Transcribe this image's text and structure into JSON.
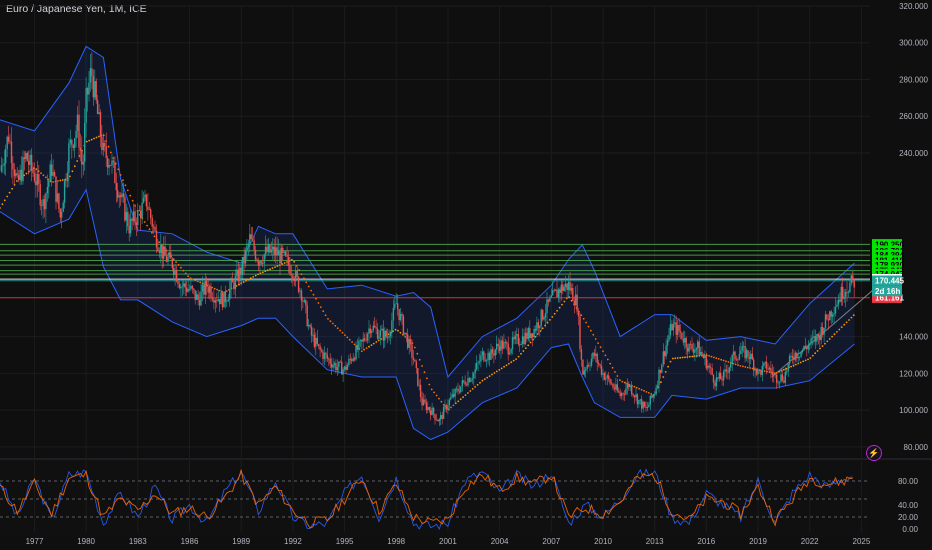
{
  "title": "Euro / Japanese Yen, 1M, ICE",
  "colors": {
    "bg": "#0f0f0f",
    "up": "#26a69a",
    "down": "#ef5350",
    "band": "#2962ff",
    "bandFill": "rgba(41,98,255,0.12)",
    "ma": "#ff9800",
    "ma2": "#ff6d00",
    "support": "#4caf50",
    "resistance": "#f23645",
    "white": "#ffffff",
    "grid": "#1c1c1c"
  },
  "icons": {
    "alert": "lightning-icon"
  },
  "chart_data": [
    {
      "type": "line",
      "title": "",
      "ylim": [
        75,
        320
      ],
      "xlim": [
        1975,
        2025.5
      ],
      "y_ticks": [
        {
          "v": 320,
          "label": "320.000"
        },
        {
          "v": 300,
          "label": "300.000"
        },
        {
          "v": 280,
          "label": "280.000"
        },
        {
          "v": 260,
          "label": "260.000"
        },
        {
          "v": 240,
          "label": "240.000"
        },
        {
          "v": 140,
          "label": "140.000"
        },
        {
          "v": 120,
          "label": "120.000"
        },
        {
          "v": 100,
          "label": "100.000"
        },
        {
          "v": 80,
          "label": "80.000"
        }
      ],
      "x_ticks": [
        "1977",
        "1980",
        "1983",
        "1986",
        "1989",
        "1992",
        "1995",
        "1998",
        "2001",
        "2004",
        "2007",
        "2010",
        "2013",
        "2016",
        "2019",
        "2022",
        "2025"
      ],
      "x_tick_years": [
        1977,
        1980,
        1983,
        1986,
        1989,
        1992,
        1995,
        1998,
        2001,
        2004,
        2007,
        2010,
        2013,
        2016,
        2019,
        2022,
        2025
      ],
      "series": [
        {
          "role": "price",
          "x": [
            1975.0,
            1975.5,
            1976.0,
            1976.5,
            1977.0,
            1977.5,
            1978.0,
            1978.5,
            1979.0,
            1979.5,
            1979.8,
            1980.0,
            1980.3,
            1980.6,
            1981.0,
            1981.4,
            1982.0,
            1982.5,
            1983.0,
            1983.5,
            1984.0,
            1984.5,
            1985.0,
            1985.5,
            1986.0,
            1986.5,
            1987.0,
            1987.5,
            1988.0,
            1988.5,
            1989.0,
            1989.5,
            1990.0,
            1990.5,
            1991.0,
            1991.5,
            1992.0,
            1992.5,
            1993.0,
            1993.5,
            1994.0,
            1994.5,
            1995.0,
            1995.5,
            1996.0,
            1996.5,
            1997.0,
            1997.5,
            1998.0,
            1998.5,
            1999.0,
            1999.5,
            2000.0,
            2000.5,
            2001.0,
            2001.5,
            2002.0,
            2002.5,
            2003.0,
            2003.5,
            2004.0,
            2004.5,
            2005.0,
            2005.5,
            2006.0,
            2006.5,
            2007.0,
            2007.5,
            2008.0,
            2008.5,
            2008.8,
            2009.0,
            2009.5,
            2010.0,
            2010.5,
            2011.0,
            2011.5,
            2012.0,
            2012.5,
            2013.0,
            2013.5,
            2014.0,
            2014.5,
            2015.0,
            2015.5,
            2016.0,
            2016.5,
            2017.0,
            2017.5,
            2018.0,
            2018.5,
            2019.0,
            2019.5,
            2020.0,
            2020.5,
            2021.0,
            2021.5,
            2022.0,
            2022.5,
            2023.0,
            2023.5,
            2024.0,
            2024.6
          ],
          "values": [
            230,
            250,
            222,
            238,
            228,
            212,
            232,
            205,
            242,
            255,
            230,
            268,
            285,
            265,
            240,
            236,
            216,
            200,
            206,
            214,
            196,
            184,
            180,
            168,
            166,
            160,
            168,
            162,
            160,
            168,
            176,
            193,
            182,
            186,
            186,
            182,
            176,
            164,
            142,
            133,
            128,
            124,
            122,
            130,
            136,
            146,
            142,
            140,
            158,
            142,
            128,
            104,
            100,
            94,
            104,
            110,
            116,
            120,
            130,
            130,
            136,
            134,
            138,
            140,
            144,
            152,
            160,
            166,
            168,
            158,
            120,
            124,
            130,
            120,
            114,
            108,
            114,
            106,
            100,
            110,
            130,
            146,
            142,
            134,
            134,
            126,
            116,
            118,
            128,
            132,
            130,
            120,
            124,
            118,
            118,
            130,
            132,
            136,
            140,
            150,
            158,
            166,
            170
          ]
        },
        {
          "role": "upper-band",
          "x": [
            1975,
            1977,
            1979,
            1980,
            1981,
            1982,
            1983,
            1985,
            1987,
            1989,
            1990,
            1991,
            1992,
            1994,
            1996,
            1998,
            1999,
            2000,
            2001,
            2003,
            2005,
            2007,
            2008,
            2008.8,
            2009.5,
            2011,
            2013,
            2014,
            2016,
            2018,
            2020,
            2022,
            2024.6
          ],
          "values": [
            258,
            252,
            278,
            298,
            292,
            226,
            198,
            196,
            186,
            180,
            200,
            196,
            196,
            166,
            168,
            162,
            164,
            156,
            118,
            140,
            150,
            168,
            182,
            190,
            176,
            140,
            152,
            152,
            138,
            140,
            136,
            158,
            180
          ]
        },
        {
          "role": "lower-band",
          "x": [
            1975,
            1977,
            1979,
            1980,
            1981,
            1982,
            1983,
            1985,
            1987,
            1989,
            1990,
            1991,
            1992,
            1994,
            1996,
            1998,
            1999,
            2000,
            2001,
            2003,
            2005,
            2007,
            2008,
            2008.8,
            2009.5,
            2011,
            2013,
            2014,
            2016,
            2018,
            2020,
            2022,
            2024.6
          ],
          "values": [
            208,
            196,
            204,
            220,
            178,
            160,
            160,
            148,
            140,
            146,
            150,
            150,
            140,
            122,
            118,
            118,
            90,
            84,
            88,
            104,
            112,
            134,
            136,
            118,
            104,
            96,
            96,
            108,
            106,
            112,
            112,
            116,
            136
          ]
        },
        {
          "role": "moving-average",
          "x": [
            1975,
            1976,
            1977,
            1978,
            1979,
            1980,
            1981,
            1982,
            1983,
            1984,
            1986,
            1988,
            1990,
            1992,
            1994,
            1996,
            1998,
            1999,
            2000,
            2001,
            2003,
            2005,
            2007,
            2008,
            2009,
            2011,
            2013,
            2014,
            2016,
            2018,
            2020,
            2022,
            2024.6
          ],
          "values": [
            210,
            225,
            232,
            224,
            226,
            246,
            250,
            228,
            208,
            194,
            172,
            164,
            174,
            182,
            150,
            132,
            144,
            136,
            112,
            100,
            116,
            128,
            150,
            162,
            148,
            116,
            108,
            128,
            130,
            124,
            120,
            128,
            152
          ]
        }
      ],
      "horizontal_levels": [
        {
          "value": 190.25,
          "label": "190.250",
          "color": "#4caf50"
        },
        {
          "value": 186.721,
          "label": "186.721",
          "color": "#4caf50"
        },
        {
          "value": 184.394,
          "label": "184.394",
          "color": "#4caf50"
        },
        {
          "value": 181.418,
          "label": "181.418",
          "color": "#4caf50"
        },
        {
          "value": 178.93,
          "label": "178.930",
          "color": "#4caf50"
        },
        {
          "value": 175.947,
          "label": "175.947",
          "color": "#4caf50"
        },
        {
          "value": 174.047,
          "label": "174.047",
          "color": "#4caf50"
        },
        {
          "value": 171.273,
          "label": "171.273",
          "color": "#ffffff"
        },
        {
          "value": 170.445,
          "label": "170.445",
          "color": "#26a69a"
        },
        {
          "value": 161.161,
          "label": "161.161",
          "color": "#f23645"
        }
      ],
      "countdown_label": "2d 16h"
    },
    {
      "type": "line",
      "title": "",
      "ylim": [
        -5,
        110
      ],
      "y_ticks": [
        {
          "v": 80,
          "label": "80.00"
        },
        {
          "v": 40,
          "label": "40.00"
        },
        {
          "v": 20,
          "label": "20.00"
        },
        {
          "v": 0,
          "label": "0.00"
        }
      ],
      "levels": [
        80,
        50,
        20
      ],
      "series": [
        {
          "role": "k",
          "color": "#2962ff",
          "x": [
            1975,
            1976,
            1977,
            1978,
            1979,
            1980,
            1981,
            1982,
            1983,
            1984,
            1985,
            1986,
            1987,
            1988,
            1989,
            1990,
            1991,
            1992,
            1993,
            1994,
            1995,
            1996,
            1997,
            1998,
            1999,
            2000,
            2001,
            2002,
            2003,
            2004,
            2005,
            2006,
            2007,
            2008,
            2009,
            2010,
            2011,
            2012,
            2013,
            2014,
            2015,
            2016,
            2017,
            2018,
            2019,
            2020,
            2021,
            2022,
            2023,
            2024,
            2024.6
          ],
          "values": [
            80,
            20,
            85,
            15,
            90,
            95,
            10,
            60,
            20,
            70,
            15,
            40,
            10,
            60,
            95,
            30,
            80,
            20,
            5,
            10,
            60,
            90,
            20,
            85,
            10,
            5,
            10,
            80,
            95,
            60,
            90,
            70,
            95,
            10,
            40,
            20,
            50,
            90,
            95,
            20,
            10,
            60,
            40,
            20,
            80,
            10,
            60,
            90,
            70,
            85,
            90
          ]
        },
        {
          "role": "d",
          "color": "#ff6d00",
          "x": [
            1975,
            1976,
            1977,
            1978,
            1979,
            1980,
            1981,
            1982,
            1983,
            1984,
            1985,
            1986,
            1987,
            1988,
            1989,
            1990,
            1991,
            1992,
            1993,
            1994,
            1995,
            1996,
            1997,
            1998,
            1999,
            2000,
            2001,
            2002,
            2003,
            2004,
            2005,
            2006,
            2007,
            2008,
            2009,
            2010,
            2011,
            2012,
            2013,
            2014,
            2015,
            2016,
            2017,
            2018,
            2019,
            2020,
            2021,
            2022,
            2023,
            2024,
            2024.6
          ],
          "values": [
            70,
            30,
            75,
            25,
            85,
            90,
            20,
            50,
            30,
            60,
            25,
            35,
            20,
            50,
            90,
            40,
            70,
            30,
            10,
            15,
            50,
            85,
            30,
            75,
            20,
            10,
            15,
            70,
            90,
            65,
            85,
            75,
            90,
            20,
            35,
            25,
            45,
            85,
            90,
            30,
            15,
            50,
            45,
            25,
            70,
            15,
            50,
            85,
            75,
            80,
            88
          ]
        }
      ]
    }
  ]
}
